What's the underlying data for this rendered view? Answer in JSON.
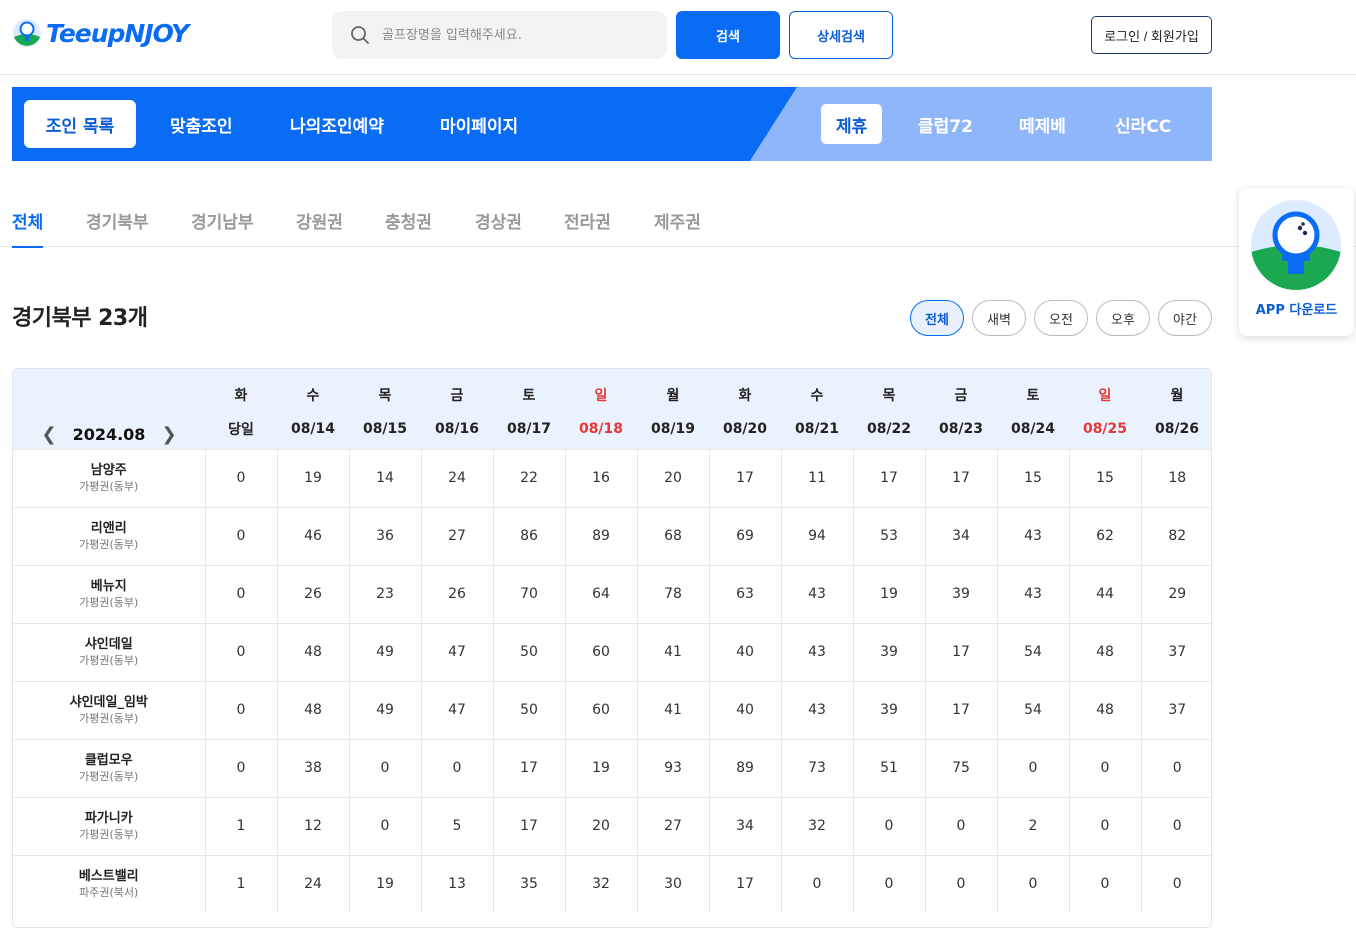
{
  "brand": {
    "logo_text": "TeeupNJOY",
    "accent": "#0a6cf5"
  },
  "search": {
    "placeholder": "골프장명을 입력해주세요.",
    "button_label": "검색",
    "detail_label": "상세검색"
  },
  "auth": {
    "login_label": "로그인 / 회원가입"
  },
  "nav": {
    "main": [
      "조인 목록",
      "맞춤조인",
      "나의조인예약",
      "마이페이지"
    ],
    "partners": [
      "제휴",
      "클럽72",
      "떼제베",
      "신라CC"
    ]
  },
  "regions": [
    "전체",
    "경기북부",
    "경기남부",
    "강원권",
    "충청권",
    "경상권",
    "전라권",
    "제주권"
  ],
  "section": {
    "title": "경기북부 23개"
  },
  "time_filters": [
    "전체",
    "새벽",
    "오전",
    "오후",
    "야간"
  ],
  "app": {
    "label": "APP 다운로드"
  },
  "calendar": {
    "month": "2024.08",
    "weekdays": [
      "화",
      "수",
      "목",
      "금",
      "토",
      "일",
      "월",
      "화",
      "수",
      "목",
      "금",
      "토",
      "일",
      "월"
    ],
    "dates": [
      "당일",
      "08/14",
      "08/15",
      "08/16",
      "08/17",
      "08/18",
      "08/19",
      "08/20",
      "08/21",
      "08/22",
      "08/23",
      "08/24",
      "08/25",
      "08/26"
    ],
    "holiday_color": "#e53935"
  },
  "courses": [
    {
      "name": "남양주",
      "area": "가평권(동부)",
      "counts": [
        "0",
        "19",
        "14",
        "24",
        "22",
        "16",
        "20",
        "17",
        "11",
        "17",
        "17",
        "15",
        "15",
        "18"
      ]
    },
    {
      "name": "리앤리",
      "area": "가평권(동부)",
      "counts": [
        "0",
        "46",
        "36",
        "27",
        "86",
        "89",
        "68",
        "69",
        "94",
        "53",
        "34",
        "43",
        "62",
        "82"
      ]
    },
    {
      "name": "베뉴지",
      "area": "가평권(동부)",
      "counts": [
        "0",
        "26",
        "23",
        "26",
        "70",
        "64",
        "78",
        "63",
        "43",
        "19",
        "39",
        "43",
        "44",
        "29"
      ]
    },
    {
      "name": "샤인데일",
      "area": "가평권(동부)",
      "counts": [
        "0",
        "48",
        "49",
        "47",
        "50",
        "60",
        "41",
        "40",
        "43",
        "39",
        "17",
        "54",
        "48",
        "37"
      ]
    },
    {
      "name": "샤인데일_임박",
      "area": "가평권(동부)",
      "counts": [
        "0",
        "48",
        "49",
        "47",
        "50",
        "60",
        "41",
        "40",
        "43",
        "39",
        "17",
        "54",
        "48",
        "37"
      ]
    },
    {
      "name": "클럽모우",
      "area": "가평권(동부)",
      "counts": [
        "0",
        "38",
        "0",
        "0",
        "17",
        "19",
        "93",
        "89",
        "73",
        "51",
        "75",
        "0",
        "0",
        "0"
      ]
    },
    {
      "name": "파가니카",
      "area": "가평권(동부)",
      "counts": [
        "1",
        "12",
        "0",
        "5",
        "17",
        "20",
        "27",
        "34",
        "32",
        "0",
        "0",
        "2",
        "0",
        "0"
      ]
    },
    {
      "name": "베스트밸리",
      "area": "파주권(북서)",
      "counts": [
        "1",
        "24",
        "19",
        "13",
        "35",
        "32",
        "30",
        "17",
        "0",
        "0",
        "0",
        "0",
        "0",
        "0"
      ]
    }
  ]
}
